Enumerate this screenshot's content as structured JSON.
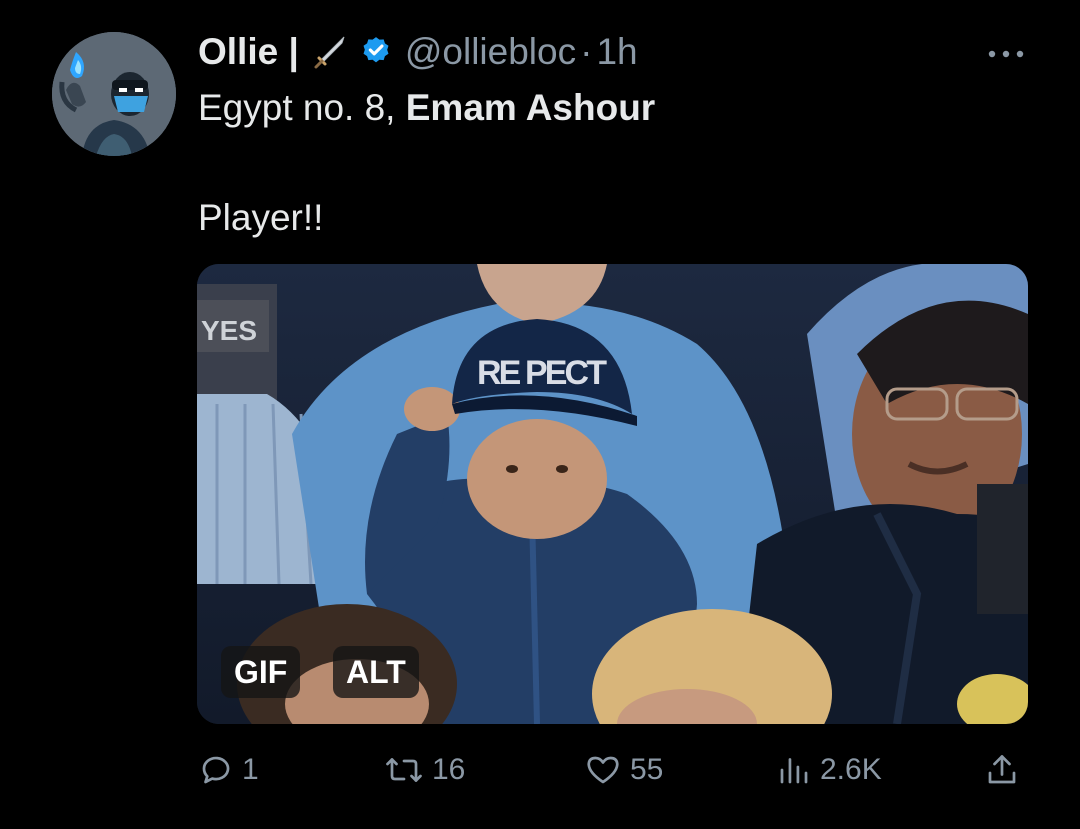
{
  "tweet": {
    "display_name": "Ollie |",
    "handle": "@olliebloc",
    "separator": "·",
    "time": "1h",
    "text_line1_normal": "Egypt no. 8, ",
    "text_line1_bold": "Emam Ashour",
    "text_line2": "Player!!"
  },
  "media": {
    "badges": {
      "gif": "GIF",
      "alt": "ALT"
    },
    "cap_text": "RE PECT",
    "sign_text": "YES"
  },
  "actions": {
    "replies": "1",
    "retweets": "16",
    "likes": "55",
    "views": "2.6K"
  },
  "icons": {
    "sword": "sword-icon",
    "verified": "verified-badge-icon",
    "more": "more-options-icon",
    "reply": "reply-icon",
    "retweet": "retweet-icon",
    "like": "heart-icon",
    "views": "views-icon",
    "share": "share-icon"
  },
  "colors": {
    "background": "#000000",
    "text": "#e7e9ea",
    "muted": "#8b98a5",
    "verified": "#1d9bf0"
  }
}
